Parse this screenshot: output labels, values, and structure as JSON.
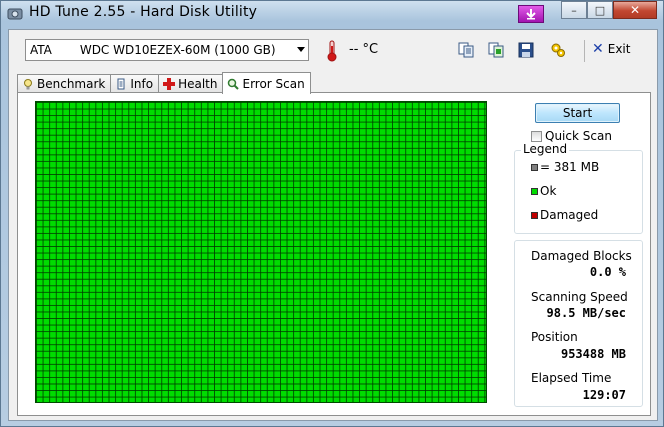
{
  "window": {
    "title": "HD Tune 2.55 - Hard Disk Utility",
    "close_glyph": "✕",
    "minimize_glyph": "–",
    "maximize_glyph": "□"
  },
  "toolbar": {
    "drive_bus": "ATA",
    "drive_name": "WDC WD10EZEX-60M (1000 GB)",
    "temperature": "-- °C",
    "icons": [
      "copy-info-icon",
      "copy-screenshot-icon",
      "save-icon",
      "options-icon"
    ],
    "exit_label": "Exit"
  },
  "tabs": [
    {
      "label": "Benchmark",
      "icon": "benchmark-icon",
      "active": false
    },
    {
      "label": "Info",
      "icon": "info-icon",
      "active": false
    },
    {
      "label": "Health",
      "icon": "health-icon",
      "active": false
    },
    {
      "label": "Error Scan",
      "icon": "error-scan-icon",
      "active": true
    }
  ],
  "error_scan": {
    "start_label": "Start",
    "quick_scan_label": "Quick Scan",
    "quick_scan_checked": false,
    "legend": {
      "title": "Legend",
      "items": [
        {
          "label": "= 381 MB",
          "color": "#808080"
        },
        {
          "label": "Ok",
          "color": "#00dc00"
        },
        {
          "label": "Damaged",
          "color": "#c00000"
        }
      ]
    },
    "stats": {
      "damaged_blocks_label": "Damaged Blocks",
      "damaged_blocks_value": "0.0 %",
      "scanning_speed_label": "Scanning Speed",
      "scanning_speed_value": "98.5 MB/sec",
      "position_label": "Position",
      "position_value": "953488 MB",
      "elapsed_time_label": "Elapsed Time",
      "elapsed_time_value": "129:07"
    },
    "grid_color_ok": "#00dc00"
  }
}
